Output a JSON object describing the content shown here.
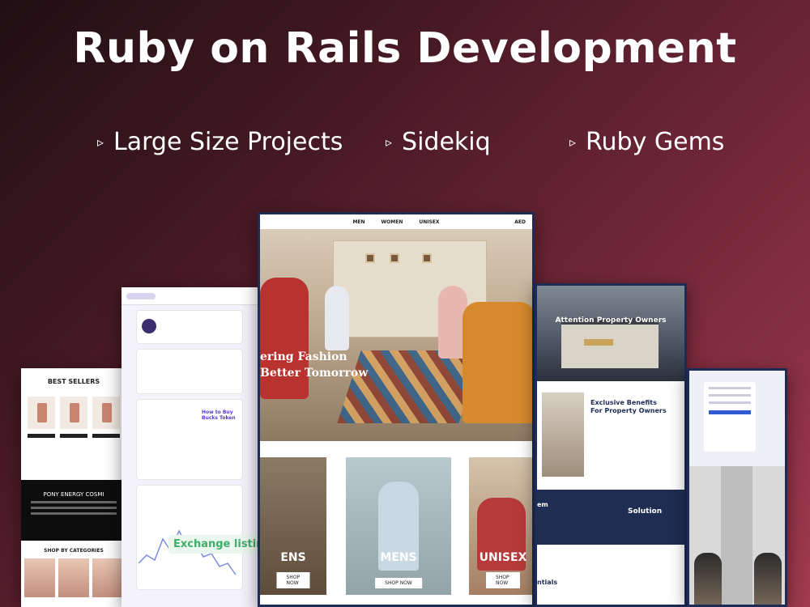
{
  "header": {
    "title": "Ruby on Rails Development",
    "features": [
      "Large Size Projects",
      "Sidekiq",
      "Ruby Gems"
    ],
    "feature_arrow": "▹"
  },
  "mockups": {
    "best_sellers": {
      "title": "BEST SELLERS",
      "brand_heading": "PONY ENERGY COSMI",
      "category_heading": "SHOP BY CATEGORIES"
    },
    "crypto": {
      "headline": "How to Buy Bucks Token",
      "exchange_badge": "Exchange listings"
    },
    "fashion": {
      "nav_items": [
        "MEN",
        "WOMEN",
        "UNISEX"
      ],
      "nav_right": "AED",
      "hero_line1": "ering Fashion",
      "hero_line2": "Better Tomorrow",
      "tiles": [
        {
          "label": "ENS",
          "button": "SHOP NOW"
        },
        {
          "label": "MENS",
          "button": "SHOP NOW"
        },
        {
          "label": "UNISEX",
          "button": "SHOP NOW"
        }
      ]
    },
    "property": {
      "hero_title": "Attention Property Owners",
      "benefits_line1": "Exclusive Benefits",
      "benefits_line2": "For Property Owners",
      "solution": "Solution",
      "em": "em",
      "essentials": "ntials"
    },
    "login": {}
  },
  "colors": {
    "bg_dark": "#1f0f14",
    "bg_light": "#a13a4f",
    "navy": "#1e2b55",
    "gold": "#c9a35a",
    "exchange_green": "#3fae6b"
  }
}
